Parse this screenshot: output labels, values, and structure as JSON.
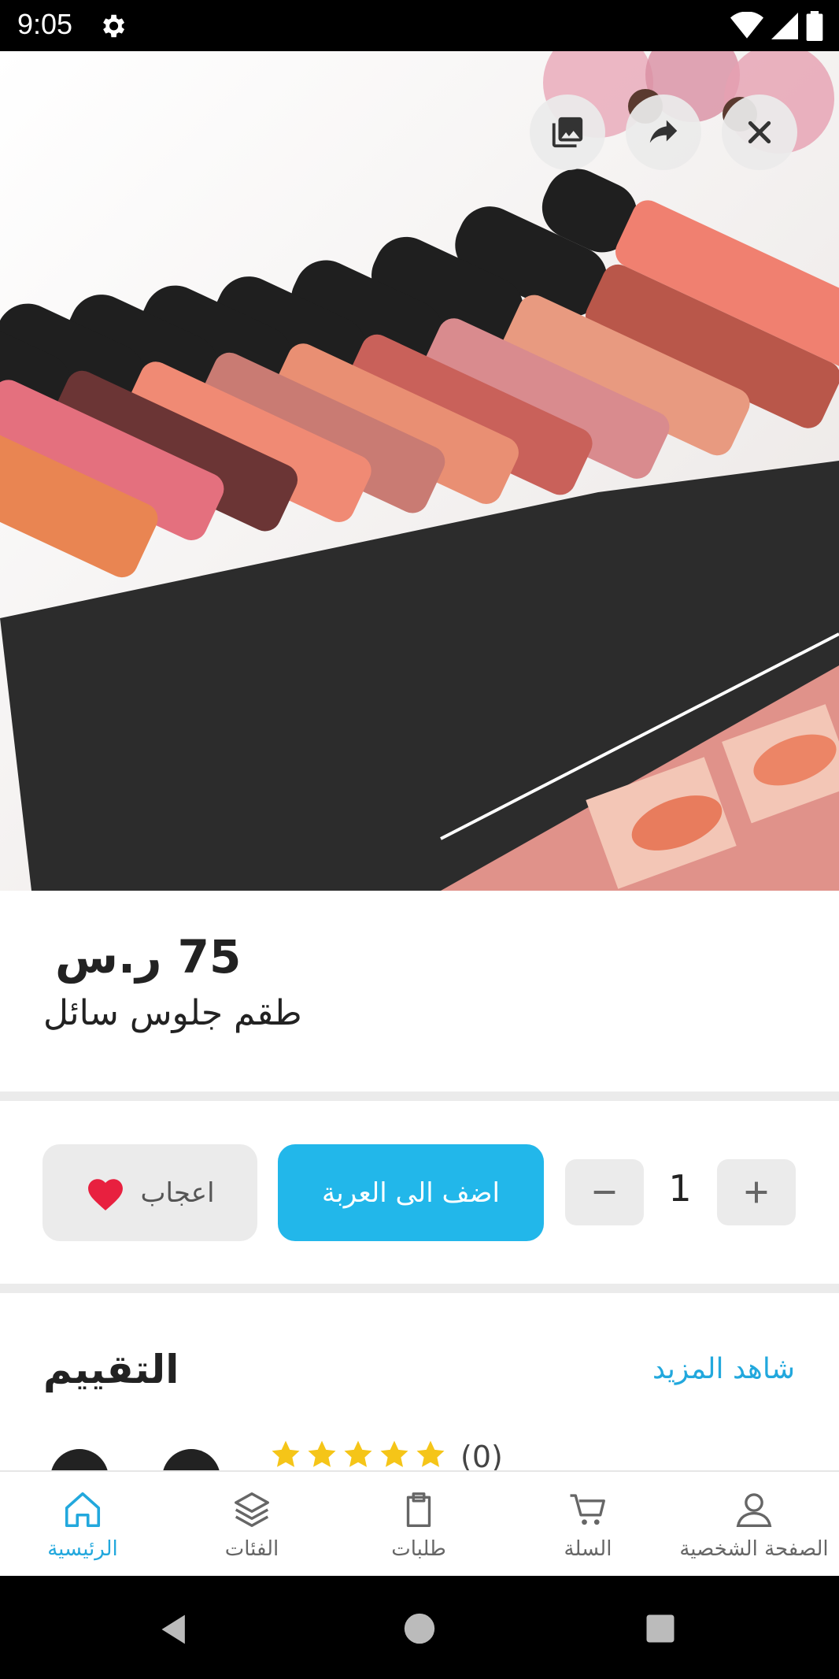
{
  "status_bar": {
    "time": "9:05"
  },
  "hero": {
    "image_alt": ""
  },
  "product": {
    "price": "75 ر.س",
    "title": "طقم جلوس سائل"
  },
  "actions": {
    "like_label": "اعجاب",
    "add_to_cart_label": "اضف الى العربة",
    "quantity": "1"
  },
  "rating": {
    "title": "التقييم",
    "see_more": "شاهد المزيد",
    "count": "(0)",
    "stars": 5
  },
  "bottom_nav": {
    "items": [
      {
        "label": "الرئيسية",
        "icon": "home-icon",
        "active": true
      },
      {
        "label": "الفئات",
        "icon": "layers-icon"
      },
      {
        "label": "طلبات",
        "icon": "clipboard-icon"
      },
      {
        "label": "السلة",
        "icon": "cart-icon"
      },
      {
        "label": "الصفحة الشخصية",
        "icon": "user-icon"
      }
    ]
  },
  "colors": {
    "accent": "#22b7ea",
    "heart": "#e8203f",
    "star": "#f5c518"
  }
}
